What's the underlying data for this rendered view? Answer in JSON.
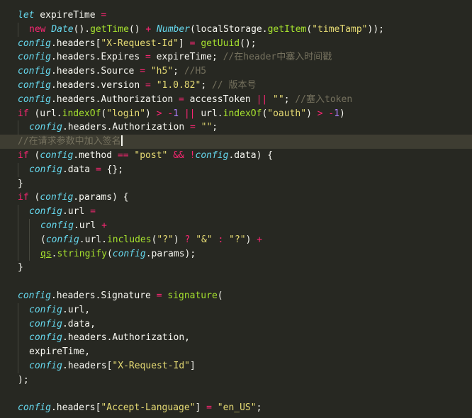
{
  "colors": {
    "background": "#272822",
    "active_line": "#3e3d32",
    "plain": "#f8f8f2",
    "keyword": "#f92672",
    "storage": "#66d9ef",
    "string": "#e6db74",
    "number": "#ae81ff",
    "function": "#a6e22e",
    "comment": "#75715e"
  },
  "editor": {
    "active_line_index": 9,
    "lines": [
      {
        "indent": 0,
        "tokens": [
          [
            "kw",
            "let"
          ],
          [
            "plain",
            " expireTime "
          ],
          [
            "op",
            "="
          ]
        ]
      },
      {
        "indent": 1,
        "tokens": [
          [
            "keyword",
            "new "
          ],
          [
            "class",
            "Date"
          ],
          [
            "plain",
            "()."
          ],
          [
            "fn",
            "getTime"
          ],
          [
            "plain",
            "() "
          ],
          [
            "op",
            "+"
          ],
          [
            "plain",
            " "
          ],
          [
            "class",
            "Number"
          ],
          [
            "plain",
            "(localStorage."
          ],
          [
            "fn",
            "getItem"
          ],
          [
            "plain",
            "("
          ],
          [
            "str",
            "\"timeTamp\""
          ],
          [
            "plain",
            "));"
          ]
        ]
      },
      {
        "indent": 0,
        "tokens": [
          [
            "var",
            "config"
          ],
          [
            "plain",
            ".headers["
          ],
          [
            "str",
            "\"X-Request-Id\""
          ],
          [
            "plain",
            "] "
          ],
          [
            "op",
            "="
          ],
          [
            "plain",
            " "
          ],
          [
            "fn",
            "getUuid"
          ],
          [
            "plain",
            "();"
          ]
        ]
      },
      {
        "indent": 0,
        "tokens": [
          [
            "var",
            "config"
          ],
          [
            "plain",
            ".headers.Expires "
          ],
          [
            "op",
            "="
          ],
          [
            "plain",
            " expireTime; "
          ],
          [
            "cm",
            "//在header中塞入时间戳"
          ]
        ]
      },
      {
        "indent": 0,
        "tokens": [
          [
            "var",
            "config"
          ],
          [
            "plain",
            ".headers.Source "
          ],
          [
            "op",
            "="
          ],
          [
            "plain",
            " "
          ],
          [
            "str",
            "\"h5\""
          ],
          [
            "plain",
            "; "
          ],
          [
            "cm",
            "//H5"
          ]
        ]
      },
      {
        "indent": 0,
        "tokens": [
          [
            "var",
            "config"
          ],
          [
            "plain",
            ".headers.version "
          ],
          [
            "op",
            "="
          ],
          [
            "plain",
            " "
          ],
          [
            "str",
            "\"1.0.82\""
          ],
          [
            "plain",
            "; "
          ],
          [
            "cm",
            "// 版本号"
          ]
        ]
      },
      {
        "indent": 0,
        "tokens": [
          [
            "var",
            "config"
          ],
          [
            "plain",
            ".headers.Authorization "
          ],
          [
            "op",
            "="
          ],
          [
            "plain",
            " accessToken "
          ],
          [
            "op",
            "||"
          ],
          [
            "plain",
            " "
          ],
          [
            "str",
            "\"\""
          ],
          [
            "plain",
            "; "
          ],
          [
            "cm",
            "//塞入token"
          ]
        ]
      },
      {
        "indent": 0,
        "tokens": [
          [
            "keyword",
            "if"
          ],
          [
            "plain",
            " (url."
          ],
          [
            "fn",
            "indexOf"
          ],
          [
            "plain",
            "("
          ],
          [
            "str",
            "\"login\""
          ],
          [
            "plain",
            ") "
          ],
          [
            "op",
            ">"
          ],
          [
            "plain",
            " "
          ],
          [
            "op",
            "-"
          ],
          [
            "num",
            "1"
          ],
          [
            "plain",
            " "
          ],
          [
            "op",
            "||"
          ],
          [
            "plain",
            " url."
          ],
          [
            "fn",
            "indexOf"
          ],
          [
            "plain",
            "("
          ],
          [
            "str",
            "\"oauth\""
          ],
          [
            "plain",
            ") "
          ],
          [
            "op",
            ">"
          ],
          [
            "plain",
            " "
          ],
          [
            "op",
            "-"
          ],
          [
            "num",
            "1"
          ],
          [
            "plain",
            ")"
          ]
        ]
      },
      {
        "indent": 1,
        "tokens": [
          [
            "var",
            "config"
          ],
          [
            "plain",
            ".headers.Authorization "
          ],
          [
            "op",
            "="
          ],
          [
            "plain",
            " "
          ],
          [
            "str",
            "\"\""
          ],
          [
            "plain",
            ";"
          ]
        ]
      },
      {
        "indent": 0,
        "tokens": [
          [
            "cm",
            "//在请求参数中加入签名"
          ]
        ],
        "caret": true
      },
      {
        "indent": 0,
        "tokens": [
          [
            "keyword",
            "if"
          ],
          [
            "plain",
            " ("
          ],
          [
            "var",
            "config"
          ],
          [
            "plain",
            ".method "
          ],
          [
            "op",
            "=="
          ],
          [
            "plain",
            " "
          ],
          [
            "str",
            "\"post\""
          ],
          [
            "plain",
            " "
          ],
          [
            "op",
            "&&"
          ],
          [
            "plain",
            " "
          ],
          [
            "op",
            "!"
          ],
          [
            "var",
            "config"
          ],
          [
            "plain",
            ".data) {"
          ]
        ]
      },
      {
        "indent": 1,
        "tokens": [
          [
            "var",
            "config"
          ],
          [
            "plain",
            ".data "
          ],
          [
            "op",
            "="
          ],
          [
            "plain",
            " {};"
          ]
        ]
      },
      {
        "indent": 0,
        "tokens": [
          [
            "plain",
            "}"
          ]
        ]
      },
      {
        "indent": 0,
        "tokens": [
          [
            "keyword",
            "if"
          ],
          [
            "plain",
            " ("
          ],
          [
            "var",
            "config"
          ],
          [
            "plain",
            ".params) {"
          ]
        ]
      },
      {
        "indent": 1,
        "tokens": [
          [
            "var",
            "config"
          ],
          [
            "plain",
            ".url "
          ],
          [
            "op",
            "="
          ]
        ]
      },
      {
        "indent": 2,
        "tokens": [
          [
            "var",
            "config"
          ],
          [
            "plain",
            ".url "
          ],
          [
            "op",
            "+"
          ]
        ]
      },
      {
        "indent": 2,
        "tokens": [
          [
            "plain",
            "("
          ],
          [
            "var",
            "config"
          ],
          [
            "plain",
            ".url."
          ],
          [
            "fn",
            "includes"
          ],
          [
            "plain",
            "("
          ],
          [
            "str",
            "\"?\""
          ],
          [
            "plain",
            ") "
          ],
          [
            "op",
            "?"
          ],
          [
            "plain",
            " "
          ],
          [
            "str",
            "\"&\""
          ],
          [
            "plain",
            " "
          ],
          [
            "op",
            ":"
          ],
          [
            "plain",
            " "
          ],
          [
            "str",
            "\"?\""
          ],
          [
            "plain",
            ") "
          ],
          [
            "op",
            "+"
          ]
        ]
      },
      {
        "indent": 2,
        "tokens": [
          [
            "u",
            "qs"
          ],
          [
            "plain",
            "."
          ],
          [
            "fn",
            "stringify"
          ],
          [
            "plain",
            "("
          ],
          [
            "var",
            "config"
          ],
          [
            "plain",
            ".params);"
          ]
        ]
      },
      {
        "indent": 0,
        "tokens": [
          [
            "plain",
            "}"
          ]
        ]
      },
      {
        "indent": 0,
        "tokens": []
      },
      {
        "indent": 0,
        "tokens": [
          [
            "var",
            "config"
          ],
          [
            "plain",
            ".headers.Signature "
          ],
          [
            "op",
            "="
          ],
          [
            "plain",
            " "
          ],
          [
            "fn",
            "signature"
          ],
          [
            "plain",
            "("
          ]
        ]
      },
      {
        "indent": 1,
        "tokens": [
          [
            "var",
            "config"
          ],
          [
            "plain",
            ".url,"
          ]
        ]
      },
      {
        "indent": 1,
        "tokens": [
          [
            "var",
            "config"
          ],
          [
            "plain",
            ".data,"
          ]
        ]
      },
      {
        "indent": 1,
        "tokens": [
          [
            "var",
            "config"
          ],
          [
            "plain",
            ".headers.Authorization,"
          ]
        ]
      },
      {
        "indent": 1,
        "tokens": [
          [
            "plain",
            "expireTime,"
          ]
        ]
      },
      {
        "indent": 1,
        "tokens": [
          [
            "var",
            "config"
          ],
          [
            "plain",
            ".headers["
          ],
          [
            "str",
            "\"X-Request-Id\""
          ],
          [
            "plain",
            "]"
          ]
        ]
      },
      {
        "indent": 0,
        "tokens": [
          [
            "plain",
            ");"
          ]
        ]
      },
      {
        "indent": 0,
        "tokens": []
      },
      {
        "indent": 0,
        "tokens": [
          [
            "var",
            "config"
          ],
          [
            "plain",
            ".headers["
          ],
          [
            "str",
            "\"Accept-Language\""
          ],
          [
            "plain",
            "] "
          ],
          [
            "op",
            "="
          ],
          [
            "plain",
            " "
          ],
          [
            "str",
            "\"en_US\""
          ],
          [
            "plain",
            ";"
          ]
        ]
      }
    ]
  }
}
